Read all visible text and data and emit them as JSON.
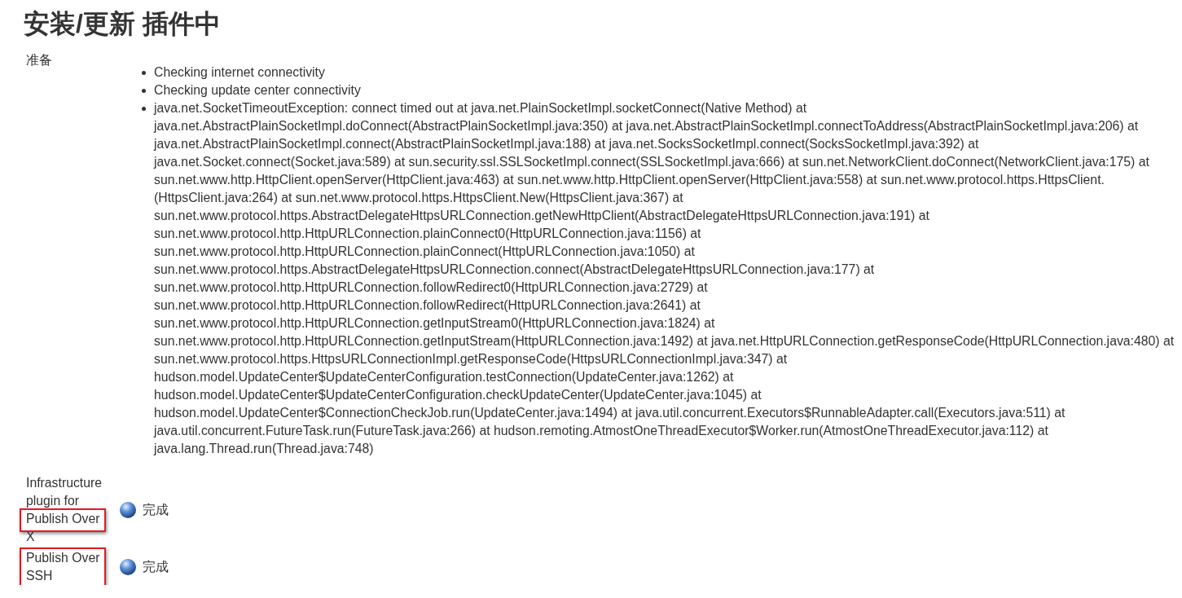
{
  "title": "安装/更新 插件中",
  "preparation": {
    "label": "准备",
    "messages": [
      "Checking internet connectivity",
      "Checking update center connectivity",
      "java.net.SocketTimeoutException: connect timed out at java.net.PlainSocketImpl.socketConnect(Native Method) at java.net.AbstractPlainSocketImpl.doConnect(AbstractPlainSocketImpl.java:350) at java.net.AbstractPlainSocketImpl.connectToAddress(AbstractPlainSocketImpl.java:206) at java.net.AbstractPlainSocketImpl.connect(AbstractPlainSocketImpl.java:188) at java.net.SocksSocketImpl.connect(SocksSocketImpl.java:392) at java.net.Socket.connect(Socket.java:589) at sun.security.ssl.SSLSocketImpl.connect(SSLSocketImpl.java:666) at sun.net.NetworkClient.doConnect(NetworkClient.java:175) at sun.net.www.http.HttpClient.openServer(HttpClient.java:463) at sun.net.www.http.HttpClient.openServer(HttpClient.java:558) at sun.net.www.protocol.https.HttpsClient.(HttpsClient.java:264) at sun.net.www.protocol.https.HttpsClient.New(HttpsClient.java:367) at sun.net.www.protocol.https.AbstractDelegateHttpsURLConnection.getNewHttpClient(AbstractDelegateHttpsURLConnection.java:191) at sun.net.www.protocol.http.HttpURLConnection.plainConnect0(HttpURLConnection.java:1156) at sun.net.www.protocol.http.HttpURLConnection.plainConnect(HttpURLConnection.java:1050) at sun.net.www.protocol.https.AbstractDelegateHttpsURLConnection.connect(AbstractDelegateHttpsURLConnection.java:177) at sun.net.www.protocol.http.HttpURLConnection.followRedirect0(HttpURLConnection.java:2729) at sun.net.www.protocol.http.HttpURLConnection.followRedirect(HttpURLConnection.java:2641) at sun.net.www.protocol.http.HttpURLConnection.getInputStream0(HttpURLConnection.java:1824) at sun.net.www.protocol.http.HttpURLConnection.getInputStream(HttpURLConnection.java:1492) at java.net.HttpURLConnection.getResponseCode(HttpURLConnection.java:480) at sun.net.www.protocol.https.HttpsURLConnectionImpl.getResponseCode(HttpsURLConnectionImpl.java:347) at hudson.model.UpdateCenter$UpdateCenterConfiguration.testConnection(UpdateCenter.java:1262) at hudson.model.UpdateCenter$UpdateCenterConfiguration.checkUpdateCenter(UpdateCenter.java:1045) at hudson.model.UpdateCenter$ConnectionCheckJob.run(UpdateCenter.java:1494) at java.util.concurrent.Executors$RunnableAdapter.call(Executors.java:511) at java.util.concurrent.FutureTask.run(FutureTask.java:266) at hudson.remoting.AtmostOneThreadExecutor$Worker.run(AtmostOneThreadExecutor.java:112) at java.lang.Thread.run(Thread.java:748)"
    ]
  },
  "plugins": [
    {
      "name_parts": [
        {
          "text": "Infrastructure plugin for ",
          "highlighted": false
        },
        {
          "text": "Publish Over",
          "highlighted": true
        },
        {
          "text": " X",
          "highlighted": false
        }
      ],
      "status": "完成"
    },
    {
      "name_parts": [
        {
          "text": "Publish Over SSH",
          "highlighted": true
        }
      ],
      "status": "完成"
    }
  ]
}
